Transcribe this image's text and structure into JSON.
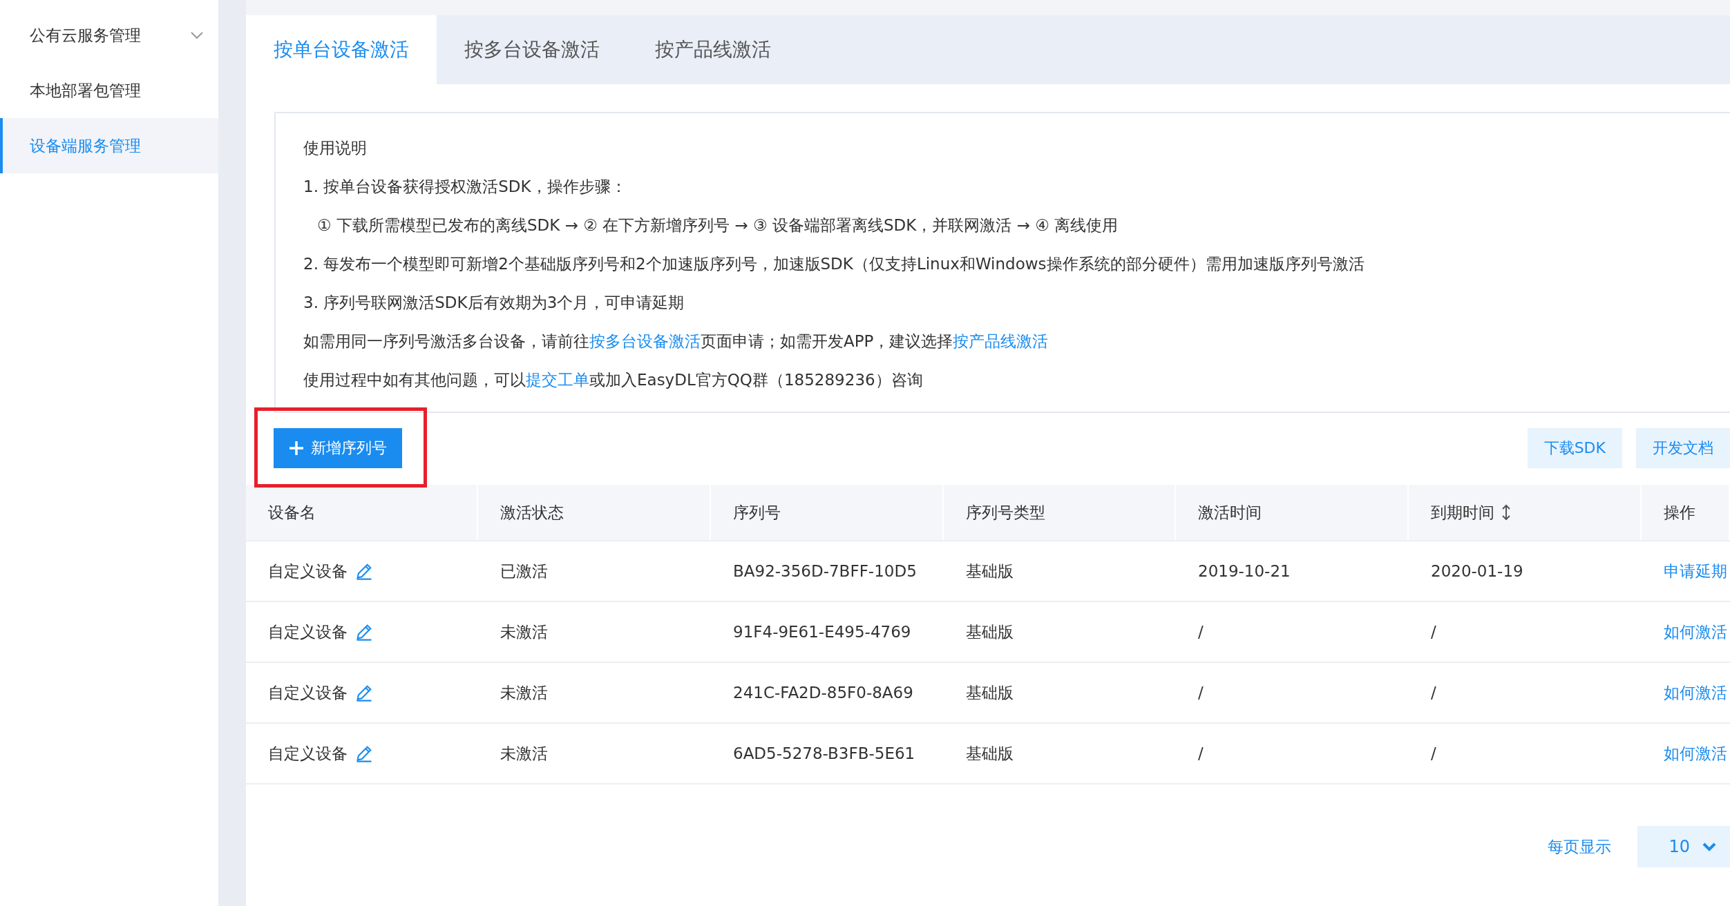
{
  "sidebar": {
    "items": [
      {
        "label": "公有云服务管理",
        "selected": false,
        "expanded": false
      },
      {
        "label": "本地部署包管理",
        "selected": false
      },
      {
        "label": "设备端服务管理",
        "selected": true
      }
    ]
  },
  "tabs": [
    {
      "label": "按单台设备激活",
      "selected": true
    },
    {
      "label": "按多台设备激活",
      "selected": false
    },
    {
      "label": "按产品线激活",
      "selected": false
    }
  ],
  "instructions": {
    "title": "使用说明",
    "lines": [
      {
        "kind": "plain",
        "parts": [
          {
            "kind": "text",
            "text": "1. 按单台设备获得授权激活SDK，操作步骤："
          }
        ]
      },
      {
        "kind": "step",
        "parts": [
          {
            "kind": "text",
            "text": "① 下载所需模型已发布的离线SDK → ② 在下方新增序列号 → ③ 设备端部署离线SDK，并联网激活 → ④ 离线使用"
          }
        ]
      },
      {
        "kind": "plain",
        "parts": [
          {
            "kind": "text",
            "text": "2. 每发布一个模型即可新增2个基础版序列号和2个加速版序列号，加速版SDK（仅支持Linux和Windows操作系统的部分硬件）需用加速版序列号激活"
          }
        ]
      },
      {
        "kind": "plain",
        "parts": [
          {
            "kind": "text",
            "text": "3. 序列号联网激活SDK后有效期为3个月，可申请延期"
          }
        ]
      },
      {
        "kind": "plain",
        "parts": [
          {
            "kind": "text",
            "text": "如需用同一序列号激活多台设备，请前往"
          },
          {
            "kind": "link",
            "text": "按多台设备激活"
          },
          {
            "kind": "text",
            "text": "页面申请；如需开发APP，建议选择"
          },
          {
            "kind": "link",
            "text": "按产品线激活"
          }
        ]
      },
      {
        "kind": "plain",
        "parts": [
          {
            "kind": "text",
            "text": "使用过程中如有其他问题，可以"
          },
          {
            "kind": "link",
            "text": "提交工单"
          },
          {
            "kind": "text",
            "text": "或加入EasyDL官方QQ群（185289236）咨询"
          }
        ]
      }
    ]
  },
  "toolbar": {
    "add_button": {
      "label": "新增序列号",
      "highlighted": true
    },
    "right_buttons": [
      "下载SDK",
      "开发文档"
    ]
  },
  "table": {
    "columns": [
      {
        "label": "设备名",
        "sortable": false
      },
      {
        "label": "激活状态",
        "sortable": false
      },
      {
        "label": "序列号",
        "sortable": false
      },
      {
        "label": "序列号类型",
        "sortable": false
      },
      {
        "label": "激活时间",
        "sortable": false
      },
      {
        "label": "到期时间",
        "sortable": true
      },
      {
        "label": "操作",
        "sortable": false
      }
    ],
    "rows": [
      {
        "device": "自定义设备",
        "status": "已激活",
        "serial": "BA92-356D-7BFF-10D5",
        "type": "基础版",
        "activated": "2019-10-21",
        "expires": "2020-01-19",
        "action": "申请延期"
      },
      {
        "device": "自定义设备",
        "status": "未激活",
        "serial": "91F4-9E61-E495-4769",
        "type": "基础版",
        "activated": "/",
        "expires": "/",
        "action": "如何激活"
      },
      {
        "device": "自定义设备",
        "status": "未激活",
        "serial": "241C-FA2D-85F0-8A69",
        "type": "基础版",
        "activated": "/",
        "expires": "/",
        "action": "如何激活"
      },
      {
        "device": "自定义设备",
        "status": "未激活",
        "serial": "6AD5-5278-B3FB-5E61",
        "type": "基础版",
        "activated": "/",
        "expires": "/",
        "action": "如何激活"
      }
    ]
  },
  "pagination": {
    "label": "每页显示",
    "page_size": "10"
  }
}
